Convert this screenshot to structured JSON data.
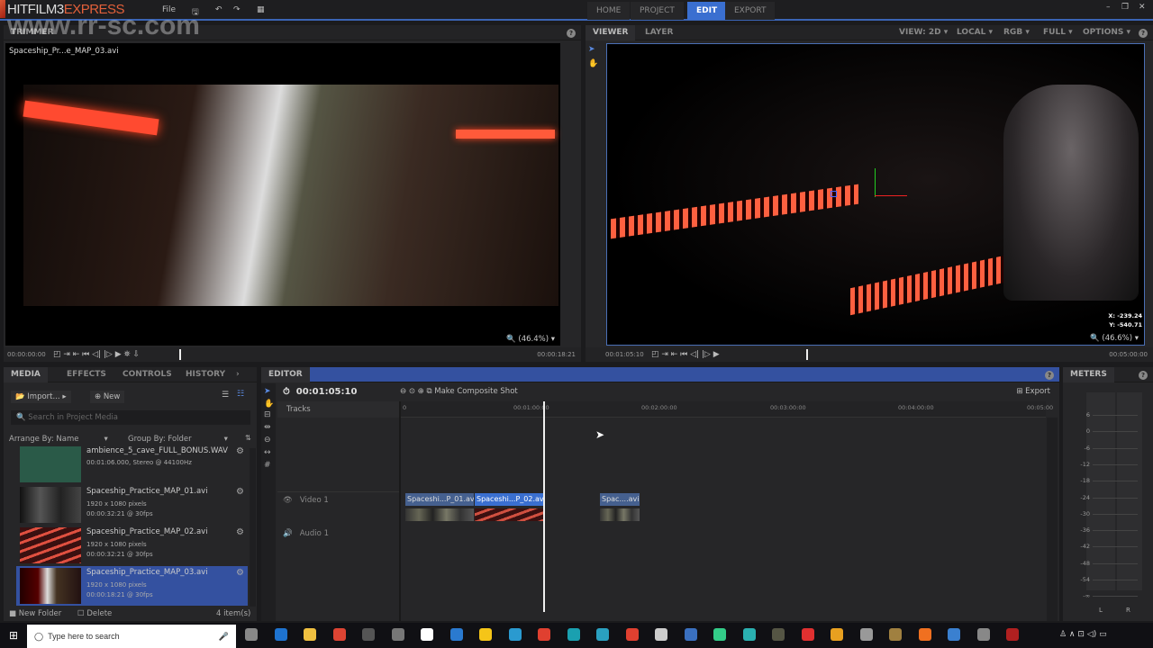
{
  "app": {
    "logo_main": "HITFILM3",
    "logo_accent": "EXPRESS",
    "menu_file": "File",
    "icons": [
      "save-icon",
      "undo-icon",
      "redo-icon",
      "grid-icon"
    ]
  },
  "main_tabs": [
    {
      "label": "HOME"
    },
    {
      "label": "PROJECT"
    },
    {
      "label": "EDIT",
      "active": true
    },
    {
      "label": "EXPORT"
    }
  ],
  "window_controls": [
    "minimize-icon",
    "restore-icon",
    "close-icon"
  ],
  "watermark": "www.rr-sc.com",
  "trimmer": {
    "title": "TRIMMER",
    "filename": "Spaceship_Pr...e_MAP_03.avi",
    "zoom": "(46.4%)",
    "time_start": "00:00:00:00",
    "time_end": "00:00:18:21"
  },
  "viewer": {
    "tabs": [
      "VIEWER",
      "LAYER"
    ],
    "options": [
      "VIEW: 2D",
      "LOCAL",
      "RGB",
      "FULL",
      "OPTIONS"
    ],
    "coord_x": "X:  -239.24",
    "coord_y": "Y:  -540.71",
    "zoom": "(46.6%)",
    "time_current": "00:01:05:10",
    "time_end": "00:05:00:00",
    "playhead_fraction": 0.218
  },
  "media": {
    "tabs": [
      "MEDIA",
      "EFFECTS",
      "CONTROLS",
      "HISTORY"
    ],
    "import_label": "Import...",
    "new_label": "New",
    "search_placeholder": "Search in Project Media",
    "arrange": "Arrange By: Name",
    "group": "Group By: Folder",
    "items": [
      {
        "name": "ambience_5_cave_FULL_BONUS.WAV",
        "line1": "00:01:06.000, Stereo @ 44100Hz",
        "line2": ""
      },
      {
        "name": "Spaceship_Practice_MAP_01.avi",
        "line1": "1920 x 1080 pixels",
        "line2": "00:00:32:21 @ 30fps"
      },
      {
        "name": "Spaceship_Practice_MAP_02.avi",
        "line1": "1920 x 1080 pixels",
        "line2": "00:00:32:21 @ 30fps"
      },
      {
        "name": "Spaceship_Practice_MAP_03.avi",
        "line1": "1920 x 1080 pixels",
        "line2": "00:00:18:21 @ 30fps",
        "selected": true
      }
    ],
    "new_folder": "New Folder",
    "delete": "Delete",
    "count": "4 item(s)"
  },
  "editor": {
    "title": "EDITOR",
    "timecode": "00:01:05:10",
    "composite": "Make Composite Shot",
    "export": "Export",
    "tracks_label": "Tracks",
    "ruler": [
      "0",
      "00:01:00:00",
      "00:02:00:00",
      "00:03:00:00",
      "00:04:00:00",
      "00:05:00"
    ],
    "video_track": "Video 1",
    "audio_track": "Audio 1",
    "clips": [
      {
        "label": "Spaceshi...P_01.avi"
      },
      {
        "label": "Spaceshi...P_02.avi",
        "selected": true
      },
      {
        "label": "Spac....avi"
      }
    ]
  },
  "meters": {
    "title": "METERS",
    "scale": [
      "6",
      "0",
      "-6",
      "-12",
      "-18",
      "-24",
      "-30",
      "-36",
      "-42",
      "-48",
      "-54",
      "-∞"
    ],
    "channels": [
      "L",
      "R"
    ]
  },
  "taskbar": {
    "search_placeholder": "Type here to search"
  },
  "colors": {
    "accent": "#3a6fd0",
    "logo_accent": "#e2603a",
    "panel": "#262628"
  }
}
